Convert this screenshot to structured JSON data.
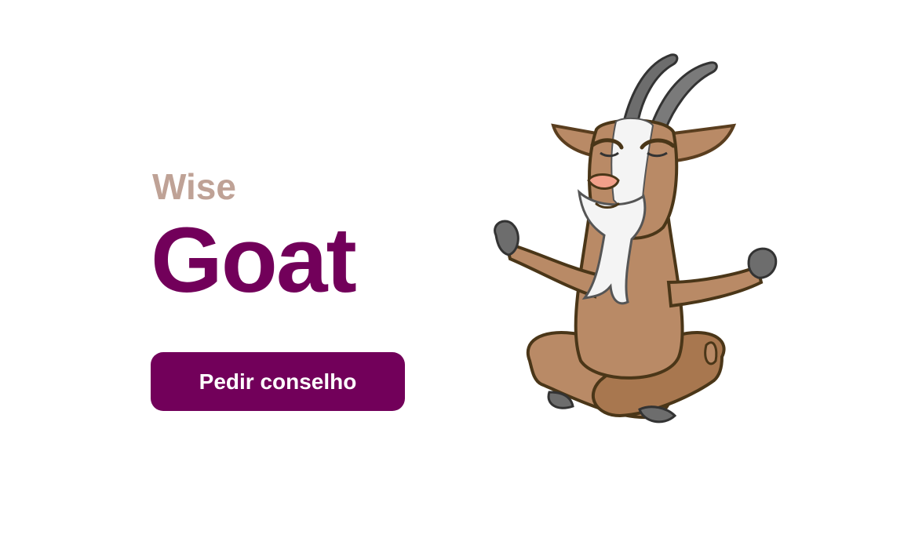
{
  "hero": {
    "subtitle": "Wise",
    "title": "Goat",
    "button_label": "Pedir conselho"
  },
  "colors": {
    "subtitle": "#bfa296",
    "title": "#72005a",
    "button_bg": "#72005a",
    "button_text": "#ffffff",
    "background": "#ffffff"
  },
  "illustration": {
    "icon": "meditating-goat-icon"
  }
}
